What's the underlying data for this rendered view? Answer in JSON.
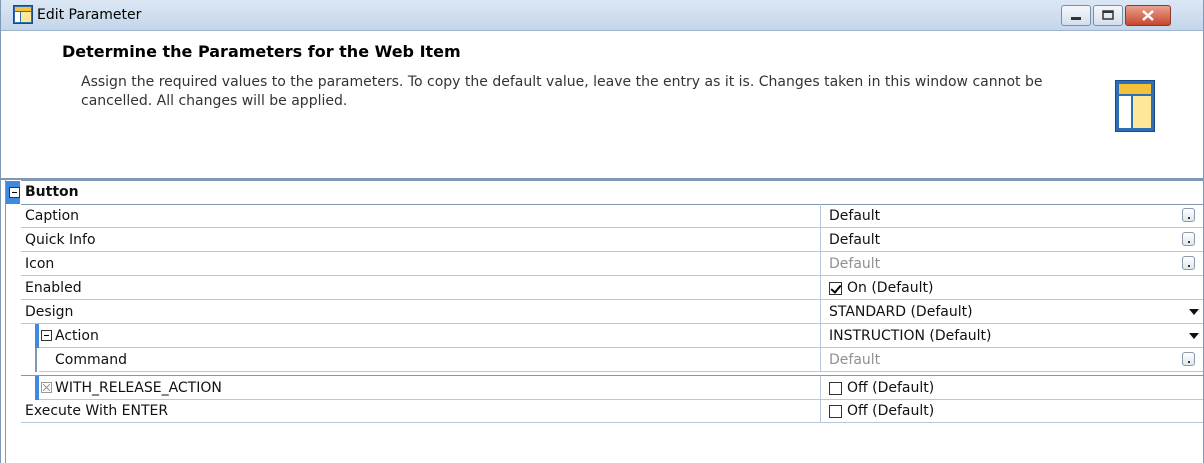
{
  "window": {
    "title": "Edit Parameter",
    "minimize_icon": "minimize-icon",
    "maximize_icon": "maximize-icon",
    "close_icon": "close-icon"
  },
  "header": {
    "title": "Determine the Parameters for the Web Item",
    "description": "Assign the required values to the parameters. To copy the default value, leave the entry as it is. Changes taken in this window cannot be cancelled. All changes will be applied."
  },
  "group": {
    "label": "Button"
  },
  "rows": [
    {
      "name": "Caption",
      "value": "Default",
      "kind": "text-button",
      "gray": false
    },
    {
      "name": "Quick Info",
      "value": "Default",
      "kind": "text-button",
      "gray": false
    },
    {
      "name": "Icon",
      "value": "Default",
      "kind": "text-button",
      "gray": true
    },
    {
      "name": "Enabled",
      "value": "On (Default)",
      "kind": "checkbox",
      "checked": true
    },
    {
      "name": "Design",
      "value": "STANDARD (Default)",
      "kind": "dropdown"
    },
    {
      "name": "Action",
      "value": "INSTRUCTION (Default)",
      "kind": "dropdown"
    },
    {
      "name": "Command",
      "value": "Default",
      "kind": "text-button",
      "gray": true
    },
    {
      "name": "WITH_RELEASE_ACTION",
      "value": "Off (Default)",
      "kind": "checkbox",
      "checked": false
    },
    {
      "name": "Execute With ENTER",
      "value": "Off (Default)",
      "kind": "checkbox",
      "checked": false
    }
  ],
  "colors": {
    "accent": "#3d8ae0",
    "border": "#7f98b5",
    "grid_line": "#b8c8dc",
    "gray_text": "#909090"
  }
}
